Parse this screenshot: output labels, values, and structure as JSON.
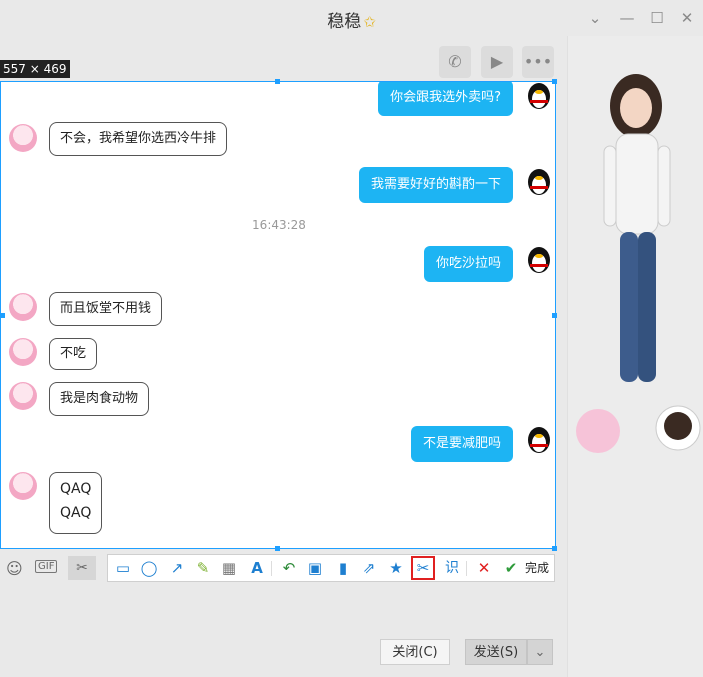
{
  "window": {
    "title": "稳稳",
    "star": "✩"
  },
  "selection": {
    "size_label": "557 × 469"
  },
  "messages": {
    "r1": "你会跟我选外卖吗?",
    "l1": "不会，我希望你选西冷牛排",
    "r2": "我需要好好的斟酌一下",
    "time": "16:43:28",
    "r3": "你吃沙拉吗",
    "l2": "而且饭堂不用钱",
    "l3": "不吃",
    "l4": "我是肉食动物",
    "r4": "不是要减肥吗",
    "l5a": "QAQ",
    "l5b": "QAQ"
  },
  "input_toolbar": {
    "gif": "GIF"
  },
  "screenshot_toolbar": {
    "ocr": "识",
    "done": "完成"
  },
  "buttons": {
    "close": "关闭(C)",
    "send": "发送(S)"
  },
  "colors": {
    "accent": "#1e9fff",
    "bubble": "#1db4f3",
    "highlight": "#e02020"
  }
}
